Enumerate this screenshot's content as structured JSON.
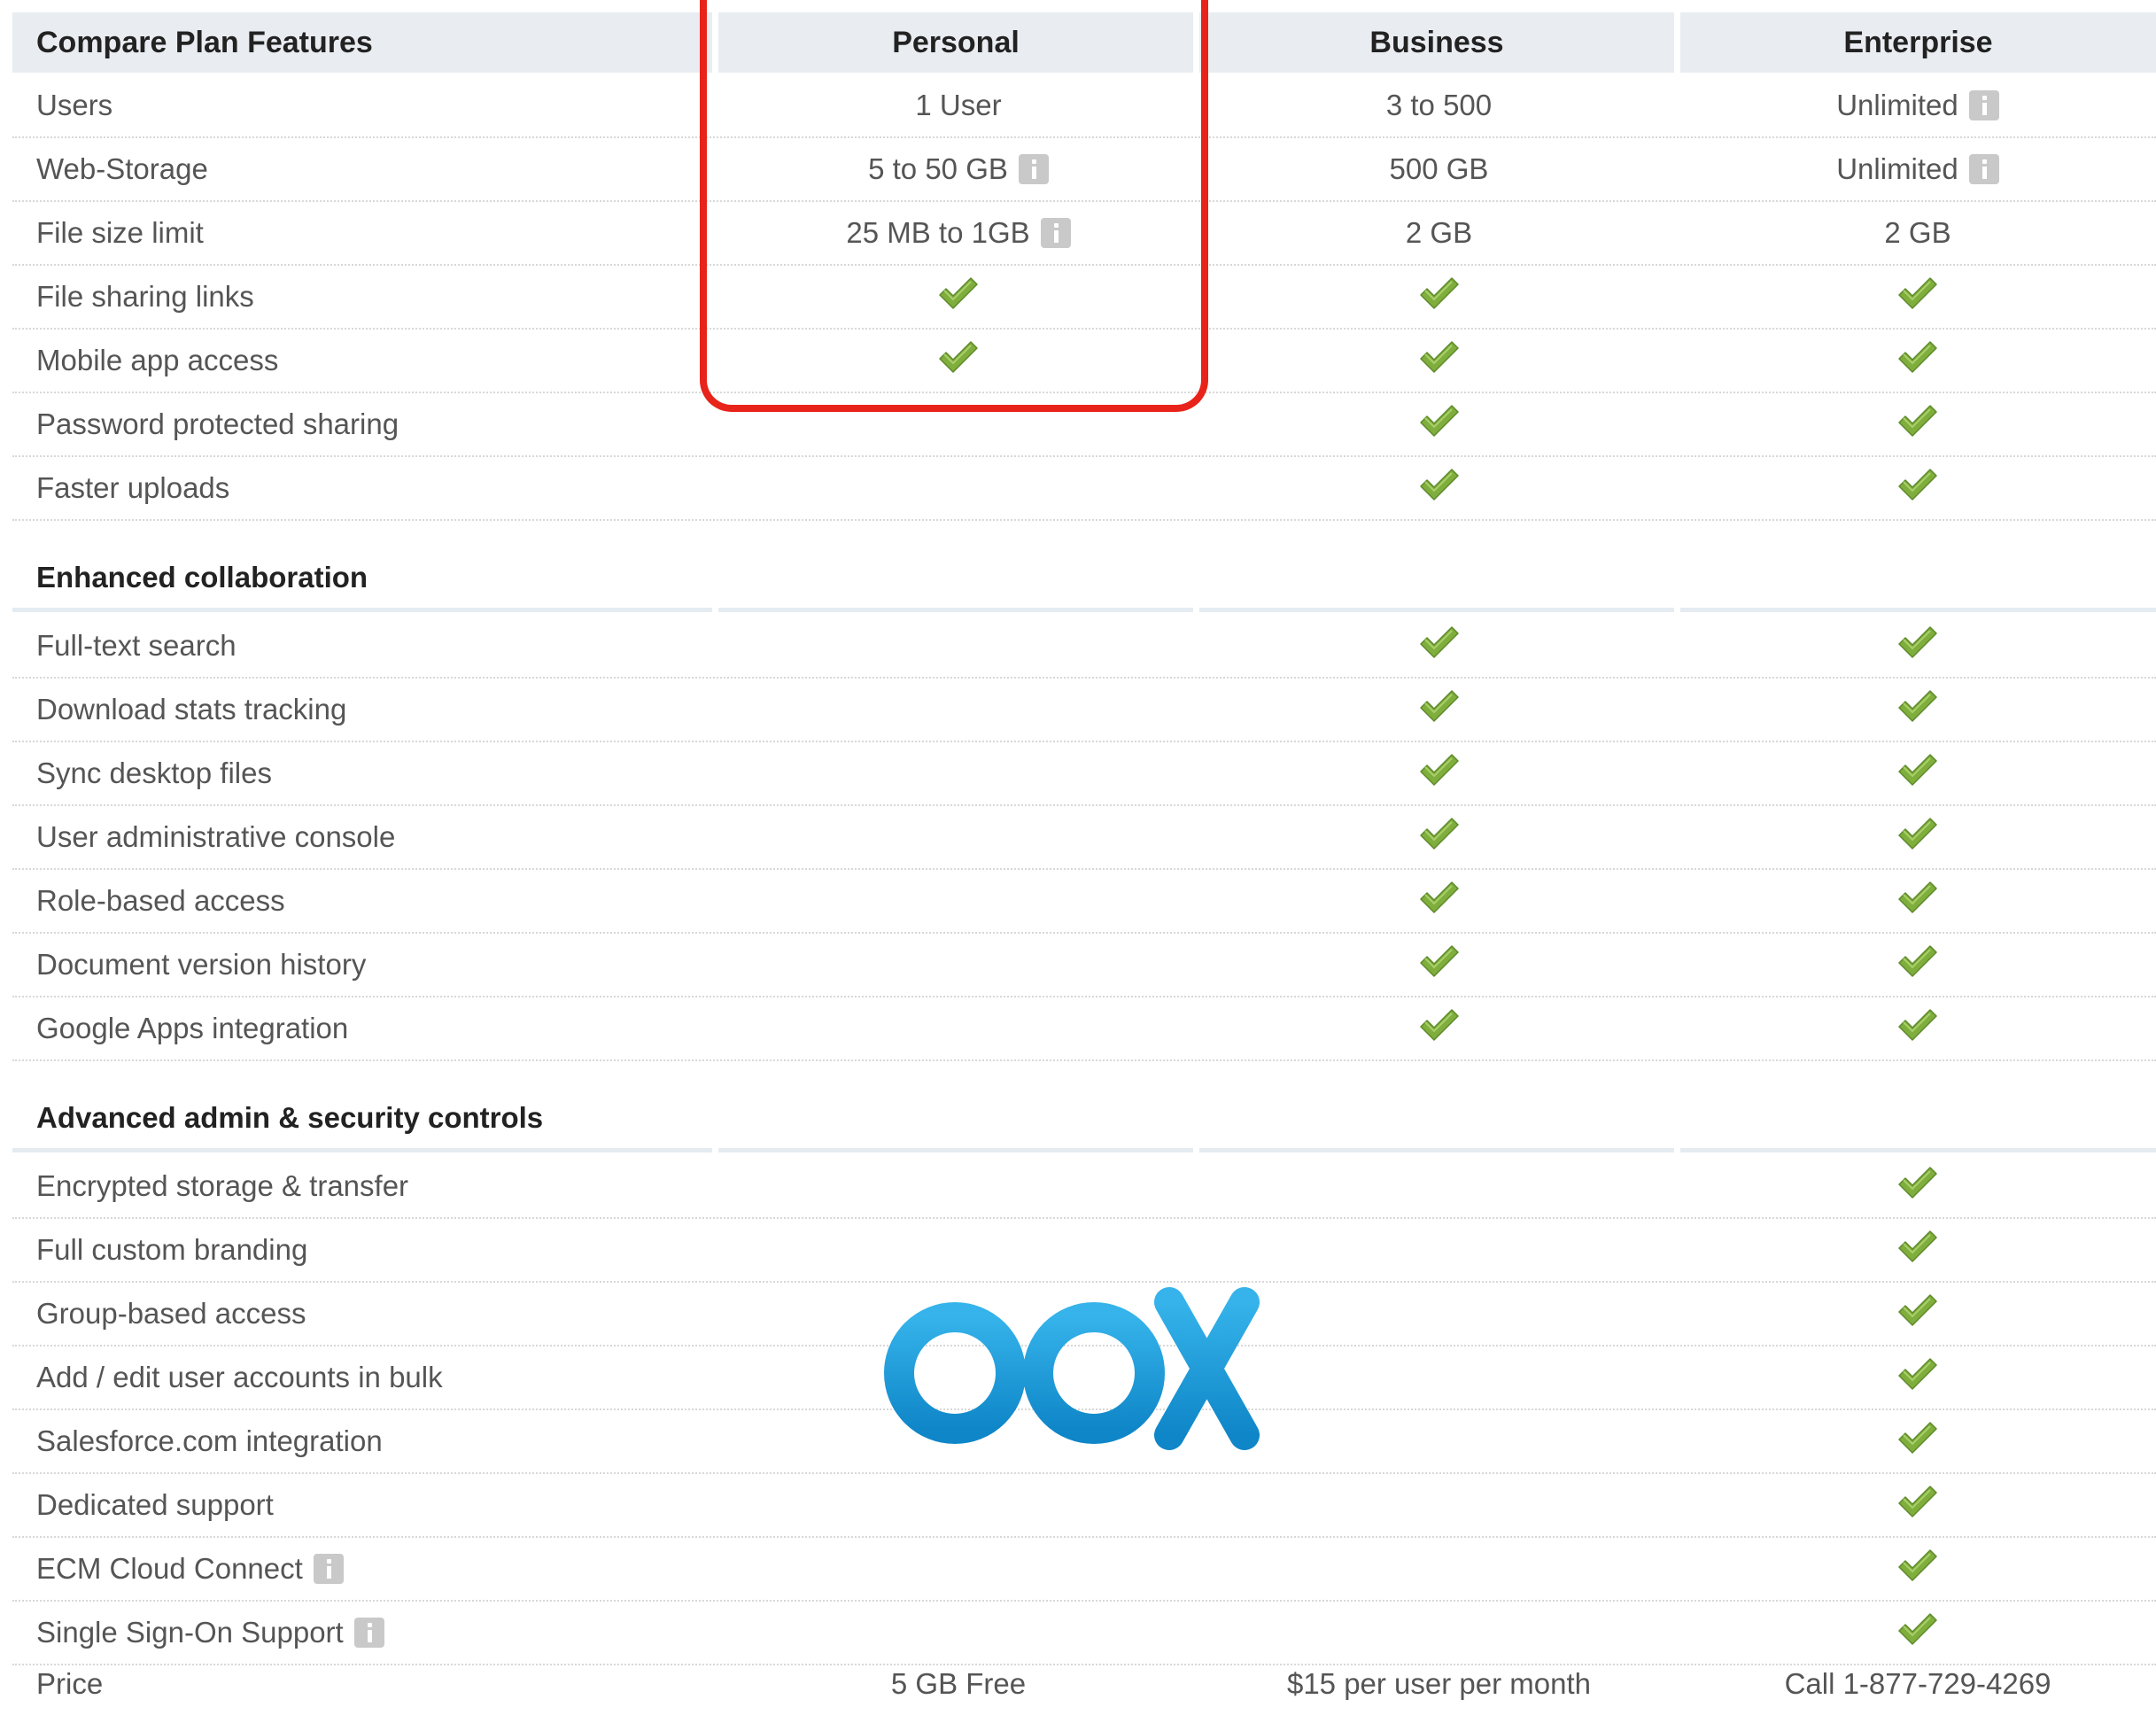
{
  "header": {
    "title": "Compare Plan Features",
    "plans": [
      "Personal",
      "Business",
      "Enterprise"
    ]
  },
  "basic_rows": [
    {
      "label": "Users",
      "cells": [
        {
          "text": "1 User"
        },
        {
          "text": "3 to 500"
        },
        {
          "text": "Unlimited",
          "info": true
        }
      ]
    },
    {
      "label": "Web-Storage",
      "cells": [
        {
          "text": "5 to 50 GB",
          "info": true
        },
        {
          "text": "500 GB"
        },
        {
          "text": "Unlimited",
          "info": true
        }
      ]
    },
    {
      "label": "File size limit",
      "cells": [
        {
          "text": "25 MB to 1GB",
          "info": true
        },
        {
          "text": "2 GB"
        },
        {
          "text": "2 GB"
        }
      ]
    },
    {
      "label": "File sharing links",
      "cells": [
        {
          "check": true
        },
        {
          "check": true
        },
        {
          "check": true
        }
      ]
    },
    {
      "label": "Mobile app access",
      "cells": [
        {
          "check": true
        },
        {
          "check": true
        },
        {
          "check": true
        }
      ]
    },
    {
      "label": "Password protected sharing",
      "cells": [
        {},
        {
          "check": true
        },
        {
          "check": true
        }
      ]
    },
    {
      "label": "Faster uploads",
      "cells": [
        {},
        {
          "check": true
        },
        {
          "check": true
        }
      ]
    }
  ],
  "sections": [
    {
      "title": "Enhanced collaboration",
      "rows": [
        {
          "label": "Full-text search",
          "cells": [
            {},
            {
              "check": true
            },
            {
              "check": true
            }
          ]
        },
        {
          "label": "Download stats tracking",
          "cells": [
            {},
            {
              "check": true
            },
            {
              "check": true
            }
          ]
        },
        {
          "label": "Sync desktop files",
          "cells": [
            {},
            {
              "check": true
            },
            {
              "check": true
            }
          ]
        },
        {
          "label": "User administrative console",
          "cells": [
            {},
            {
              "check": true
            },
            {
              "check": true
            }
          ]
        },
        {
          "label": "Role-based access",
          "cells": [
            {},
            {
              "check": true
            },
            {
              "check": true
            }
          ]
        },
        {
          "label": "Document version history",
          "cells": [
            {},
            {
              "check": true
            },
            {
              "check": true
            }
          ]
        },
        {
          "label": "Google Apps integration",
          "cells": [
            {},
            {
              "check": true
            },
            {
              "check": true
            }
          ]
        }
      ]
    },
    {
      "title": "Advanced admin & security controls",
      "rows": [
        {
          "label": "Encrypted storage & transfer",
          "cells": [
            {},
            {},
            {
              "check": true
            }
          ]
        },
        {
          "label": "Full custom branding",
          "cells": [
            {},
            {},
            {
              "check": true
            }
          ]
        },
        {
          "label": "Group-based access",
          "cells": [
            {},
            {},
            {
              "check": true
            }
          ]
        },
        {
          "label": "Add / edit user accounts in bulk",
          "cells": [
            {},
            {},
            {
              "check": true
            }
          ]
        },
        {
          "label": "Salesforce.com integration",
          "cells": [
            {},
            {},
            {
              "check": true
            }
          ]
        },
        {
          "label": "Dedicated support",
          "cells": [
            {},
            {},
            {
              "check": true
            }
          ]
        },
        {
          "label": "ECM Cloud Connect",
          "info": true,
          "cells": [
            {},
            {},
            {
              "check": true
            }
          ]
        },
        {
          "label": "Single Sign-On Support",
          "info": true,
          "cells": [
            {},
            {},
            {
              "check": true
            }
          ]
        }
      ]
    }
  ],
  "price_row": {
    "label": "Price",
    "cells": [
      "5 GB Free",
      "$15 per user per month",
      "Call 1-877-729-4269"
    ]
  },
  "logo": {
    "text": "box",
    "color": "#1a9ad6"
  },
  "colors": {
    "header_bg": "#e9edf1",
    "highlight": "#e8231a",
    "check": "#7fae3d",
    "info": "#c9c9c9"
  }
}
